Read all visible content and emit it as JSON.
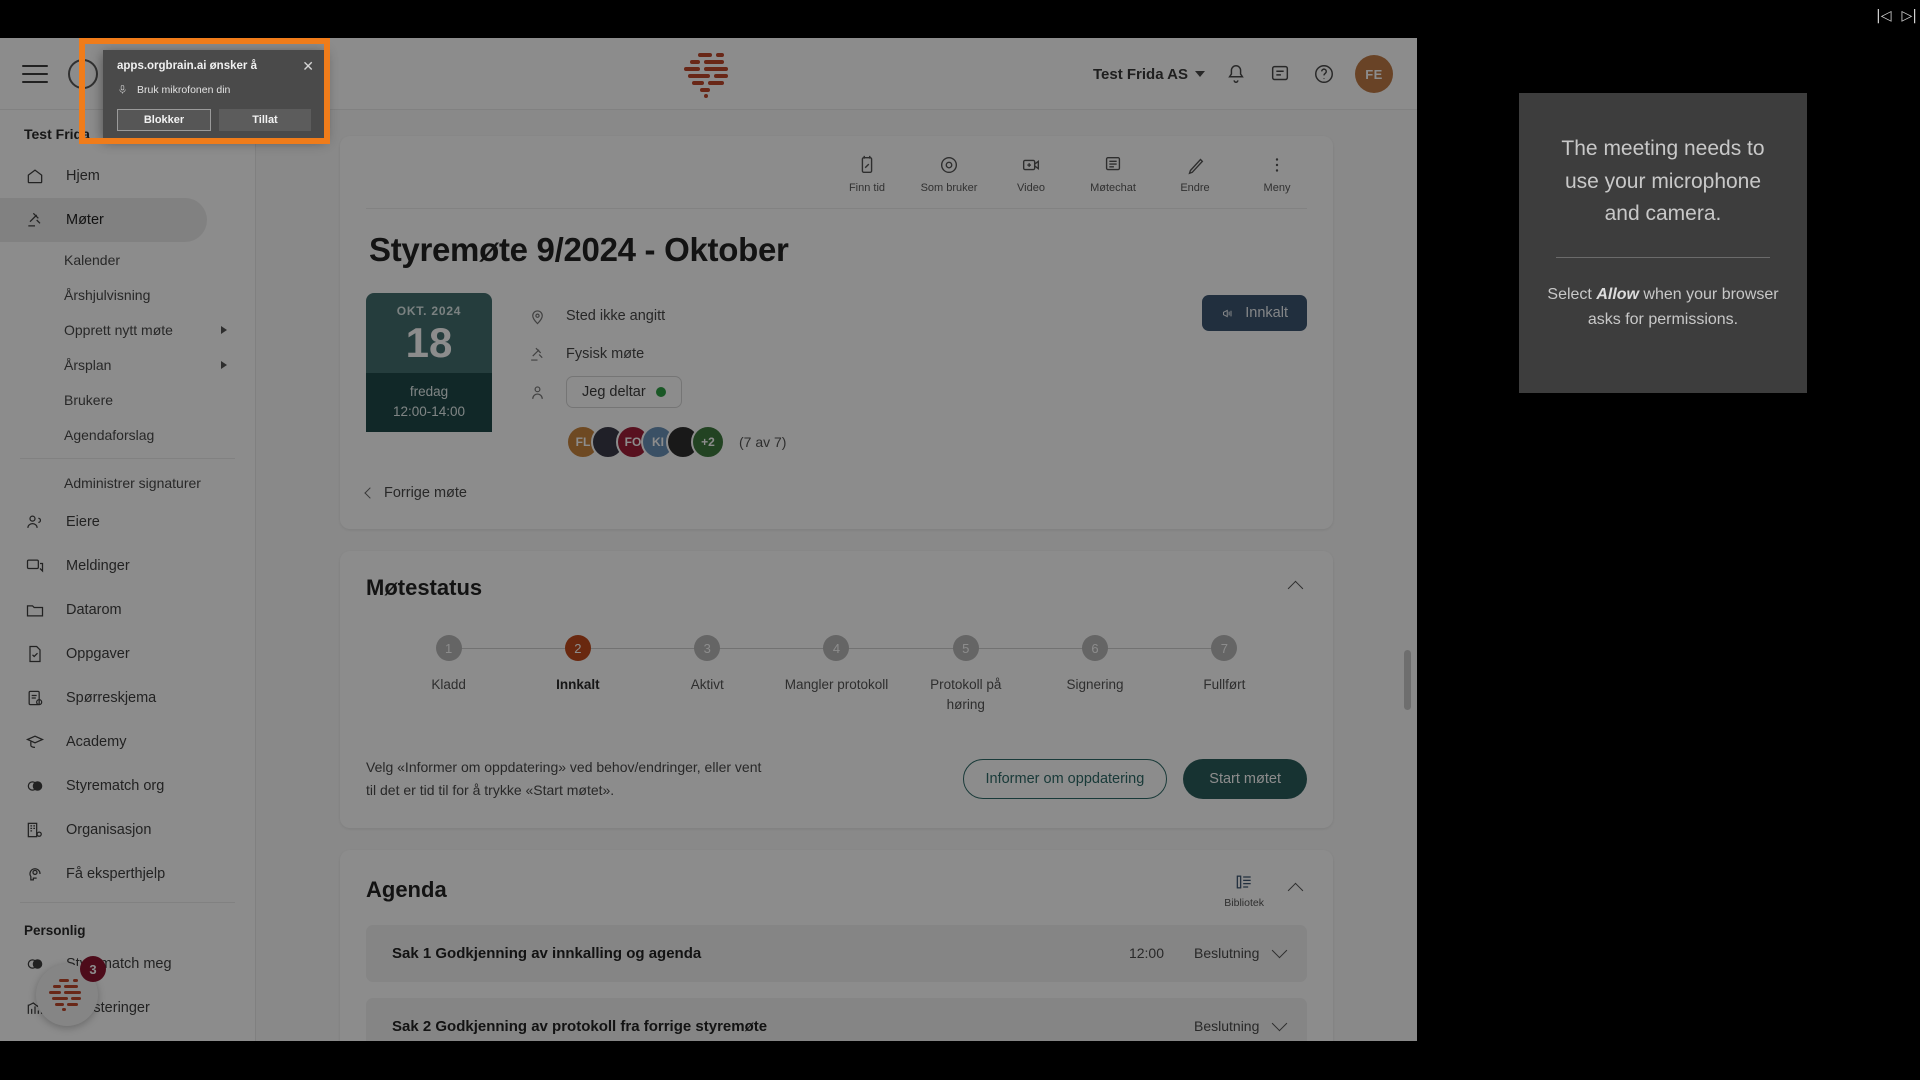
{
  "header": {
    "logo_icon": "brain-logo",
    "menu_icon": "hamburger-menu-icon",
    "org_selector": "Test Frida AS",
    "bell_icon": "bell-icon",
    "chat_icon": "chat-icon",
    "help_icon": "help-circle-icon",
    "avatar_initials": "FE",
    "nav_prev": "|◁",
    "nav_next": "▷|"
  },
  "sidebar": {
    "title": "Test Frida",
    "items": [
      {
        "label": "Hjem",
        "icon": "home-icon"
      },
      {
        "label": "Møter",
        "icon": "gavel-icon",
        "active": true
      }
    ],
    "sub_items": [
      {
        "label": "Kalender",
        "arrow": false
      },
      {
        "label": "Årshjulvisning",
        "arrow": false
      },
      {
        "label": "Opprett nytt møte",
        "arrow": true
      },
      {
        "label": "Årsplan",
        "arrow": true
      },
      {
        "label": "Brukere",
        "arrow": false
      },
      {
        "label": "Agendaforslag",
        "arrow": false
      }
    ],
    "signatures_label": "Administrer signaturer",
    "items2": [
      {
        "label": "Eiere",
        "icon": "users-icon"
      },
      {
        "label": "Meldinger",
        "icon": "messages-icon"
      },
      {
        "label": "Datarom",
        "icon": "folder-icon"
      },
      {
        "label": "Oppgaver",
        "icon": "task-check-icon"
      },
      {
        "label": "Spørreskjema",
        "icon": "clipboard-check-icon"
      },
      {
        "label": "Academy",
        "icon": "graduation-cap-icon"
      },
      {
        "label": "Styrematch org",
        "icon": "contrast-circles-icon"
      },
      {
        "label": "Organisasjon",
        "icon": "building-gear-icon"
      },
      {
        "label": "Få eksperthjelp",
        "icon": "head-gear-icon"
      }
    ],
    "personal_section": "Personlig",
    "items3": [
      {
        "label": "Styrematch meg",
        "icon": "contrast-circles-icon"
      },
      {
        "label": "Investeringer",
        "icon": "chart-line-icon"
      }
    ],
    "float_badge_count": "3",
    "float_bubble_icon": "brain-logo-small"
  },
  "meeting": {
    "toolbar": [
      {
        "label": "Finn tid",
        "icon": "calendar-edit-icon"
      },
      {
        "label": "Som bruker",
        "icon": "eye-icon"
      },
      {
        "label": "Video",
        "icon": "video-add-icon"
      },
      {
        "label": "Møtechat",
        "icon": "chat-lines-icon"
      },
      {
        "label": "Endre",
        "icon": "pencil-icon"
      },
      {
        "label": "Meny",
        "icon": "dots-vertical-icon"
      }
    ],
    "title": "Styremøte 9/2024 - Oktober",
    "date_card": {
      "month_year": "OKT. 2024",
      "day_number": "18",
      "weekday": "fredag",
      "time_range": "12:00-14:00"
    },
    "location": "Sted ikke angitt",
    "location_icon": "pin-icon",
    "type": "Fysisk møte",
    "type_icon": "gavel-icon",
    "attend_icon": "person-icon",
    "attend_chip": "Jeg deltar",
    "attend_dot_color": "#2f9e44",
    "avatars": [
      {
        "initials": "FL",
        "color": "#c9863f"
      },
      {
        "initials": "",
        "color": "#3b3b4a"
      },
      {
        "initials": "FO",
        "color": "#a0203a"
      },
      {
        "initials": "KI",
        "color": "#6b93b8"
      },
      {
        "initials": "",
        "color": "#2f2f2f"
      },
      {
        "initials": "+2",
        "color": "#3f7a3f"
      }
    ],
    "attendee_count": "(7 av 7)",
    "innkalt_button": "Innkalt",
    "innkalt_icon": "megaphone-icon",
    "prev_meeting_link": "Forrige møte"
  },
  "status_card": {
    "title": "Møtestatus",
    "collapse_icon": "chevron-up-icon",
    "steps": [
      {
        "n": "1",
        "label": "Kladd"
      },
      {
        "n": "2",
        "label": "Innkalt",
        "current": true
      },
      {
        "n": "3",
        "label": "Aktivt"
      },
      {
        "n": "4",
        "label": "Mangler protokoll"
      },
      {
        "n": "5",
        "label": "Protokoll på høring"
      },
      {
        "n": "6",
        "label": "Signering"
      },
      {
        "n": "7",
        "label": "Fullført"
      }
    ],
    "hint": "Velg «Informer om oppdatering» ved behov/endringer, eller vent til det er tid til for å trykke «Start møtet».",
    "btn_outline": "Informer om oppdatering",
    "btn_solid": "Start møtet",
    "accent_current": "#bf4a1c",
    "accent_teal": "#2a5e5c"
  },
  "agenda": {
    "title": "Agenda",
    "library_label": "Bibliotek",
    "library_icon": "library-list-icon",
    "collapse_icon": "chevron-up-icon",
    "rows": [
      {
        "name": "Sak 1 Godkjenning av innkalling og agenda",
        "time": "12:00",
        "type": "Beslutning",
        "expand_icon": "chevron-down-icon"
      },
      {
        "name": "Sak 2 Godkjenning av protokoll fra forrige styremøte",
        "time": "",
        "type": "Beslutning",
        "expand_icon": "chevron-down-icon"
      }
    ]
  },
  "right_panel": {
    "headline": "The meeting needs to use your microphone and camera.",
    "instruction_pre": "Select ",
    "instruction_bold": "Allow",
    "instruction_post": " when your browser asks for permissions."
  },
  "permission_dialog": {
    "title": "apps.orgbrain.ai ønsker å",
    "close_icon": "close-icon",
    "mic_icon": "microphone-icon",
    "mic_label": "Bruk mikrofonen din",
    "block_button": "Blokker",
    "allow_button": "Tillat",
    "highlight_color": "#f07c1a"
  }
}
